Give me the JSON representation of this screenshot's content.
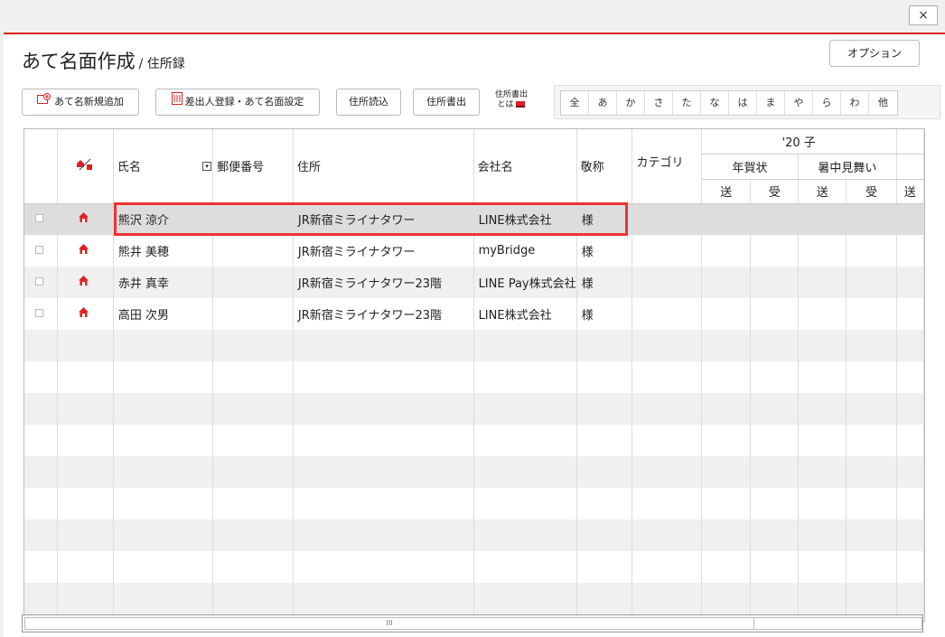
{
  "window": {
    "close_label": "×"
  },
  "title": {
    "main": "あて名面作成",
    "sub": "/ 住所録"
  },
  "option_label": "オプション",
  "toolbar": {
    "add_label": "あて名新規追加",
    "sender_label": "差出人登録・あて名面設定",
    "import_label": "住所読込",
    "export_label": "住所書出",
    "export_note_1": "住所書出",
    "export_note_2": "とは"
  },
  "kana": [
    "全",
    "あ",
    "か",
    "さ",
    "た",
    "な",
    "は",
    "ま",
    "や",
    "ら",
    "わ",
    "他"
  ],
  "columns": {
    "name": "氏名",
    "postal": "郵便番号",
    "address": "住所",
    "company": "会社名",
    "honorific": "敬称",
    "category": "カテゴリ",
    "year_group": "'20 子",
    "nenga": "年賀状",
    "shochu": "暑中見舞い",
    "sent": "送",
    "received": "受"
  },
  "rows": [
    {
      "name": "熊沢 涼介",
      "address": "JR新宿ミライナタワー",
      "company": "LINE株式会社",
      "honorific": "様"
    },
    {
      "name": "熊井 美穂",
      "address": "JR新宿ミライナタワー",
      "company": "myBridge",
      "honorific": "様"
    },
    {
      "name": "赤井 真幸",
      "address": "JR新宿ミライナタワー23階",
      "company": "LINE Pay株式会社",
      "honorific": "様"
    },
    {
      "name": "高田 次男",
      "address": "JR新宿ミライナタワー23階",
      "company": "LINE株式会社",
      "honorific": "様"
    }
  ],
  "scroll_grip": "III",
  "colors": {
    "accent": "#dd2222",
    "highlight": "#ee3333"
  }
}
